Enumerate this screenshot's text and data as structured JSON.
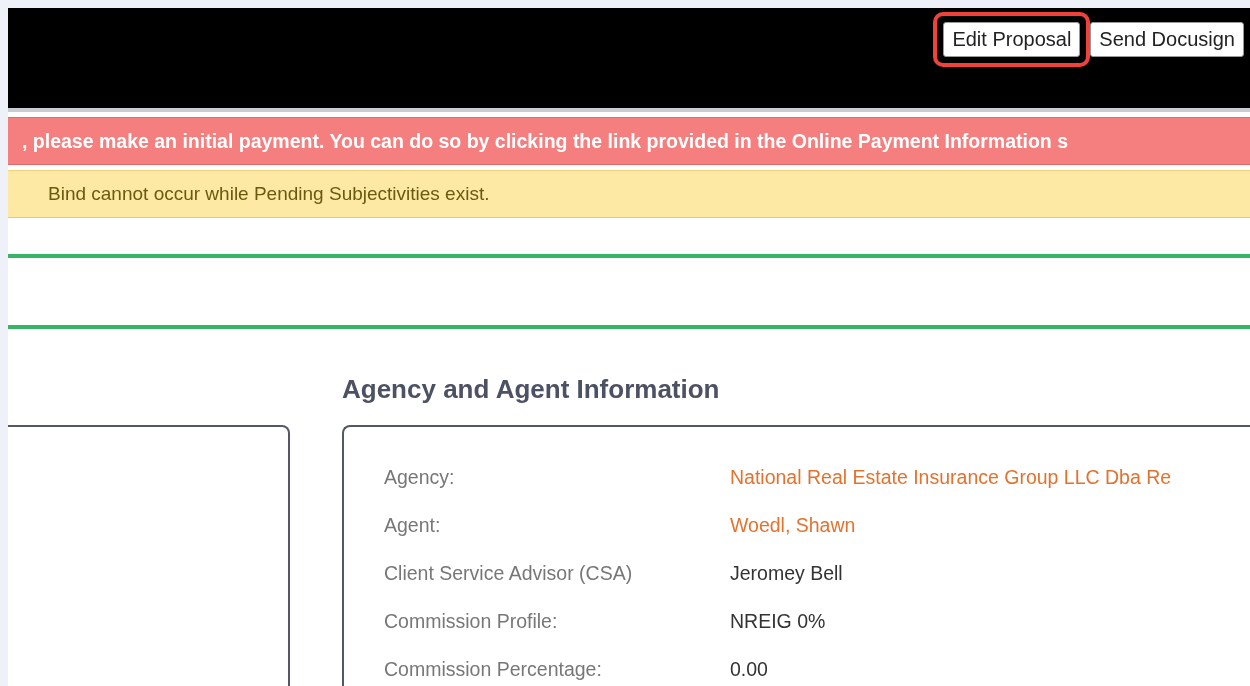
{
  "header": {
    "buttons": [
      {
        "label": "Edit Proposal",
        "highlighted": true
      },
      {
        "label": "Send Docusign",
        "highlighted": false
      }
    ]
  },
  "alerts": [
    {
      "kind": "danger",
      "text": ", please make an initial payment. You can do so by clicking the link provided in the Online Payment Information s"
    },
    {
      "kind": "warning",
      "text": "Bind cannot occur while Pending Subjectivities exist."
    }
  ],
  "agency_section": {
    "title": "Agency and Agent Information",
    "rows": [
      {
        "label": "Agency:",
        "value": "National Real Estate Insurance Group LLC Dba Re",
        "kind": "link"
      },
      {
        "label": "Agent:",
        "value": "Woedl, Shawn",
        "kind": "link"
      },
      {
        "label": "Client Service Advisor (CSA)",
        "value": "Jeromey Bell",
        "kind": "text"
      },
      {
        "label": "Commission Profile:",
        "value": "NREIG 0%",
        "kind": "text"
      },
      {
        "label": "Commission Percentage:",
        "value": "0.00",
        "kind": "text"
      }
    ]
  }
}
